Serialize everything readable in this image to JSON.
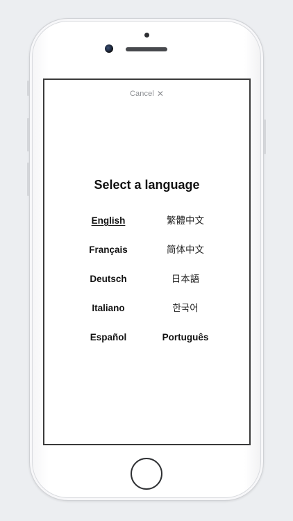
{
  "dialog": {
    "cancel_label": "Cancel",
    "cancel_icon": "close-icon",
    "title": "Select a language"
  },
  "languages": {
    "left": [
      "English",
      "Français",
      "Deutsch",
      "Italiano",
      "Español"
    ],
    "right": [
      "繁體中文",
      "简体中文",
      "日本語",
      "한국어",
      "Português"
    ],
    "selected": "English"
  },
  "colors": {
    "background": "#eceef1",
    "screen": "#ffffff",
    "text": "#111111",
    "muted": "#8d8f93"
  }
}
